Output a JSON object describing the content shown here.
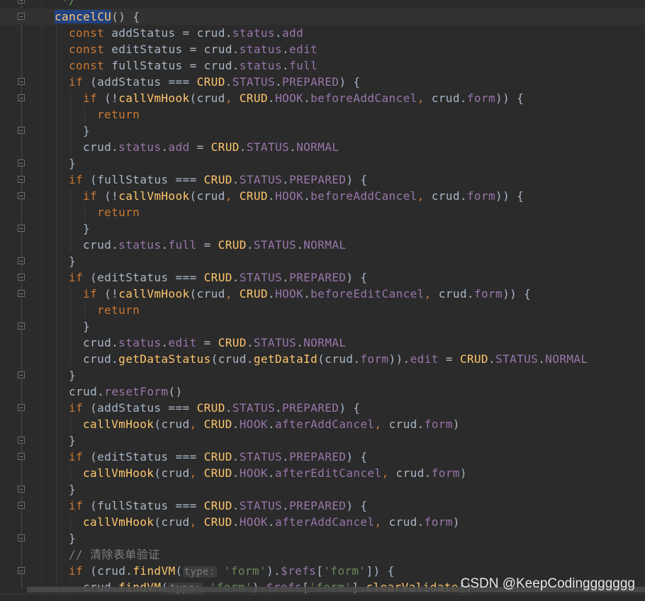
{
  "editor": {
    "lines": [
      {
        "indent": 0,
        "tokens": [
          [
            "d",
            " */"
          ]
        ]
      },
      {
        "indent": 0,
        "current": true,
        "tokens": [
          [
            "sel",
            "cancelCU"
          ],
          [
            "t",
            "() {"
          ]
        ]
      },
      {
        "indent": 1,
        "tokens": [
          [
            "k",
            "const "
          ],
          [
            "t",
            "addStatus = crud."
          ],
          [
            "p",
            "status"
          ],
          [
            "t",
            "."
          ],
          [
            "p",
            "add"
          ]
        ]
      },
      {
        "indent": 1,
        "tokens": [
          [
            "k",
            "const "
          ],
          [
            "t",
            "editStatus = crud."
          ],
          [
            "p",
            "status"
          ],
          [
            "t",
            "."
          ],
          [
            "p",
            "edit"
          ]
        ]
      },
      {
        "indent": 1,
        "tokens": [
          [
            "k",
            "const "
          ],
          [
            "t",
            "fullStatus = crud."
          ],
          [
            "p",
            "status"
          ],
          [
            "t",
            "."
          ],
          [
            "p",
            "full"
          ]
        ]
      },
      {
        "indent": 1,
        "tokens": [
          [
            "k",
            "if "
          ],
          [
            "t",
            "(addStatus === "
          ],
          [
            "c",
            "CRUD"
          ],
          [
            "t",
            "."
          ],
          [
            "p",
            "STATUS"
          ],
          [
            "t",
            "."
          ],
          [
            "p",
            "PREPARED"
          ],
          [
            "t",
            ") {"
          ]
        ]
      },
      {
        "indent": 2,
        "tokens": [
          [
            "k",
            "if "
          ],
          [
            "t",
            "(!"
          ],
          [
            "f",
            "callVmHook"
          ],
          [
            "t",
            "(crud"
          ],
          [
            "o",
            ", "
          ],
          [
            "c",
            "CRUD"
          ],
          [
            "t",
            "."
          ],
          [
            "p",
            "HOOK"
          ],
          [
            "t",
            "."
          ],
          [
            "p",
            "beforeAddCancel"
          ],
          [
            "o",
            ", "
          ],
          [
            "t",
            "crud."
          ],
          [
            "p",
            "form"
          ],
          [
            "t",
            ")) {"
          ]
        ]
      },
      {
        "indent": 3,
        "tokens": [
          [
            "k",
            "return"
          ]
        ]
      },
      {
        "indent": 2,
        "tokens": [
          [
            "t",
            "}"
          ]
        ]
      },
      {
        "indent": 2,
        "tokens": [
          [
            "t",
            "crud."
          ],
          [
            "p",
            "status"
          ],
          [
            "t",
            "."
          ],
          [
            "p",
            "add"
          ],
          [
            "t",
            " = "
          ],
          [
            "c",
            "CRUD"
          ],
          [
            "t",
            "."
          ],
          [
            "p",
            "STATUS"
          ],
          [
            "t",
            "."
          ],
          [
            "p",
            "NORMAL"
          ]
        ]
      },
      {
        "indent": 1,
        "tokens": [
          [
            "t",
            "}"
          ]
        ]
      },
      {
        "indent": 1,
        "tokens": [
          [
            "k",
            "if "
          ],
          [
            "t",
            "(fullStatus === "
          ],
          [
            "c",
            "CRUD"
          ],
          [
            "t",
            "."
          ],
          [
            "p",
            "STATUS"
          ],
          [
            "t",
            "."
          ],
          [
            "p",
            "PREPARED"
          ],
          [
            "t",
            ") {"
          ]
        ]
      },
      {
        "indent": 2,
        "tokens": [
          [
            "k",
            "if "
          ],
          [
            "t",
            "(!"
          ],
          [
            "f",
            "callVmHook"
          ],
          [
            "t",
            "(crud"
          ],
          [
            "o",
            ", "
          ],
          [
            "c",
            "CRUD"
          ],
          [
            "t",
            "."
          ],
          [
            "p",
            "HOOK"
          ],
          [
            "t",
            "."
          ],
          [
            "p",
            "beforeAddCancel"
          ],
          [
            "o",
            ", "
          ],
          [
            "t",
            "crud."
          ],
          [
            "p",
            "form"
          ],
          [
            "t",
            ")) {"
          ]
        ]
      },
      {
        "indent": 3,
        "tokens": [
          [
            "k",
            "return"
          ]
        ]
      },
      {
        "indent": 2,
        "tokens": [
          [
            "t",
            "}"
          ]
        ]
      },
      {
        "indent": 2,
        "tokens": [
          [
            "t",
            "crud."
          ],
          [
            "p",
            "status"
          ],
          [
            "t",
            "."
          ],
          [
            "p",
            "full"
          ],
          [
            "t",
            " = "
          ],
          [
            "c",
            "CRUD"
          ],
          [
            "t",
            "."
          ],
          [
            "p",
            "STATUS"
          ],
          [
            "t",
            "."
          ],
          [
            "p",
            "NORMAL"
          ]
        ]
      },
      {
        "indent": 1,
        "tokens": [
          [
            "t",
            "}"
          ]
        ]
      },
      {
        "indent": 1,
        "tokens": [
          [
            "k",
            "if "
          ],
          [
            "t",
            "(editStatus === "
          ],
          [
            "c",
            "CRUD"
          ],
          [
            "t",
            "."
          ],
          [
            "p",
            "STATUS"
          ],
          [
            "t",
            "."
          ],
          [
            "p",
            "PREPARED"
          ],
          [
            "t",
            ") {"
          ]
        ]
      },
      {
        "indent": 2,
        "tokens": [
          [
            "k",
            "if "
          ],
          [
            "t",
            "(!"
          ],
          [
            "f",
            "callVmHook"
          ],
          [
            "t",
            "(crud"
          ],
          [
            "o",
            ", "
          ],
          [
            "c",
            "CRUD"
          ],
          [
            "t",
            "."
          ],
          [
            "p",
            "HOOK"
          ],
          [
            "t",
            "."
          ],
          [
            "p",
            "beforeEditCancel"
          ],
          [
            "o",
            ", "
          ],
          [
            "t",
            "crud."
          ],
          [
            "p",
            "form"
          ],
          [
            "t",
            ")) {"
          ]
        ]
      },
      {
        "indent": 3,
        "tokens": [
          [
            "k",
            "return"
          ]
        ]
      },
      {
        "indent": 2,
        "tokens": [
          [
            "t",
            "}"
          ]
        ]
      },
      {
        "indent": 2,
        "tokens": [
          [
            "t",
            "crud."
          ],
          [
            "p",
            "status"
          ],
          [
            "t",
            "."
          ],
          [
            "p",
            "edit"
          ],
          [
            "t",
            " = "
          ],
          [
            "c",
            "CRUD"
          ],
          [
            "t",
            "."
          ],
          [
            "p",
            "STATUS"
          ],
          [
            "t",
            "."
          ],
          [
            "p",
            "NORMAL"
          ]
        ]
      },
      {
        "indent": 2,
        "tokens": [
          [
            "t",
            "crud."
          ],
          [
            "f",
            "getDataStatus"
          ],
          [
            "t",
            "(crud."
          ],
          [
            "f",
            "getDataId"
          ],
          [
            "t",
            "(crud."
          ],
          [
            "p",
            "form"
          ],
          [
            "t",
            "))."
          ],
          [
            "p",
            "edit"
          ],
          [
            "t",
            " = "
          ],
          [
            "c",
            "CRUD"
          ],
          [
            "t",
            "."
          ],
          [
            "p",
            "STATUS"
          ],
          [
            "t",
            "."
          ],
          [
            "p",
            "NORMAL"
          ]
        ]
      },
      {
        "indent": 1,
        "tokens": [
          [
            "t",
            "}"
          ]
        ]
      },
      {
        "indent": 1,
        "tokens": [
          [
            "t",
            "crud."
          ],
          [
            "p",
            "resetForm"
          ],
          [
            "t",
            "()"
          ]
        ]
      },
      {
        "indent": 1,
        "tokens": [
          [
            "k",
            "if "
          ],
          [
            "t",
            "(addStatus === "
          ],
          [
            "c",
            "CRUD"
          ],
          [
            "t",
            "."
          ],
          [
            "p",
            "STATUS"
          ],
          [
            "t",
            "."
          ],
          [
            "p",
            "PREPARED"
          ],
          [
            "t",
            ") {"
          ]
        ]
      },
      {
        "indent": 2,
        "tokens": [
          [
            "f",
            "callVmHook"
          ],
          [
            "t",
            "(crud"
          ],
          [
            "o",
            ", "
          ],
          [
            "c",
            "CRUD"
          ],
          [
            "t",
            "."
          ],
          [
            "p",
            "HOOK"
          ],
          [
            "t",
            "."
          ],
          [
            "p",
            "afterAddCancel"
          ],
          [
            "o",
            ", "
          ],
          [
            "t",
            "crud."
          ],
          [
            "p",
            "form"
          ],
          [
            "t",
            ")"
          ]
        ]
      },
      {
        "indent": 1,
        "tokens": [
          [
            "t",
            "}"
          ]
        ]
      },
      {
        "indent": 1,
        "tokens": [
          [
            "k",
            "if "
          ],
          [
            "t",
            "(editStatus === "
          ],
          [
            "c",
            "CRUD"
          ],
          [
            "t",
            "."
          ],
          [
            "p",
            "STATUS"
          ],
          [
            "t",
            "."
          ],
          [
            "p",
            "PREPARED"
          ],
          [
            "t",
            ") {"
          ]
        ]
      },
      {
        "indent": 2,
        "tokens": [
          [
            "f",
            "callVmHook"
          ],
          [
            "t",
            "(crud"
          ],
          [
            "o",
            ", "
          ],
          [
            "c",
            "CRUD"
          ],
          [
            "t",
            "."
          ],
          [
            "p",
            "HOOK"
          ],
          [
            "t",
            "."
          ],
          [
            "p",
            "afterEditCancel"
          ],
          [
            "o",
            ", "
          ],
          [
            "t",
            "crud."
          ],
          [
            "p",
            "form"
          ],
          [
            "t",
            ")"
          ]
        ]
      },
      {
        "indent": 1,
        "tokens": [
          [
            "t",
            "}"
          ]
        ]
      },
      {
        "indent": 1,
        "tokens": [
          [
            "k",
            "if "
          ],
          [
            "t",
            "(fullStatus === "
          ],
          [
            "c",
            "CRUD"
          ],
          [
            "t",
            "."
          ],
          [
            "p",
            "STATUS"
          ],
          [
            "t",
            "."
          ],
          [
            "p",
            "PREPARED"
          ],
          [
            "t",
            ") {"
          ]
        ]
      },
      {
        "indent": 2,
        "tokens": [
          [
            "f",
            "callVmHook"
          ],
          [
            "t",
            "(crud"
          ],
          [
            "o",
            ", "
          ],
          [
            "c",
            "CRUD"
          ],
          [
            "t",
            "."
          ],
          [
            "p",
            "HOOK"
          ],
          [
            "t",
            "."
          ],
          [
            "p",
            "afterAddCancel"
          ],
          [
            "o",
            ", "
          ],
          [
            "t",
            "crud."
          ],
          [
            "p",
            "form"
          ],
          [
            "t",
            ")"
          ]
        ]
      },
      {
        "indent": 1,
        "tokens": [
          [
            "t",
            "}"
          ]
        ]
      },
      {
        "indent": 1,
        "tokens": [
          [
            "m",
            "// 清除表单验证"
          ]
        ]
      },
      {
        "indent": 1,
        "tokens": [
          [
            "k",
            "if "
          ],
          [
            "t",
            "(crud."
          ],
          [
            "f",
            "findVM"
          ],
          [
            "t",
            "("
          ],
          [
            "h",
            "type:"
          ],
          [
            "t",
            " "
          ],
          [
            "s",
            "'form'"
          ],
          [
            "t",
            ")."
          ],
          [
            "p",
            "$refs"
          ],
          [
            "t",
            "["
          ],
          [
            "s",
            "'form'"
          ],
          [
            "t",
            "]) {"
          ]
        ]
      },
      {
        "indent": 2,
        "tokens": [
          [
            "t",
            "crud."
          ],
          [
            "f",
            "findVM"
          ],
          [
            "t",
            "("
          ],
          [
            "h",
            "type:"
          ],
          [
            "t",
            " "
          ],
          [
            "s",
            "'form'"
          ],
          [
            "t",
            ")."
          ],
          [
            "p",
            "$refs"
          ],
          [
            "t",
            "["
          ],
          [
            "s",
            "'form'"
          ],
          [
            "t",
            "]."
          ],
          [
            "f",
            "clearValidate"
          ],
          [
            "t",
            "()"
          ]
        ]
      }
    ],
    "fold_lines": [
      0,
      1,
      5,
      6,
      8,
      10,
      11,
      12,
      14,
      16,
      17,
      18,
      20,
      23,
      25,
      27,
      28,
      30,
      31,
      33,
      35
    ]
  },
  "watermark": "CSDN @KeepCodinggggggg"
}
